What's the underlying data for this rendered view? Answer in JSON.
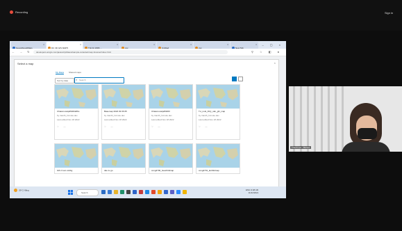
{
  "meeting": {
    "recording_label": "Recording",
    "sign_in_label": "Sign in",
    "participant_name": "Thanh Lan - BA/QA"
  },
  "browser": {
    "tabs": [
      {
        "label": "GeoodGoodMaps",
        "icon": "blue-circle-icon",
        "color": "#2b6cc4",
        "active": false
      },
      {
        "label": "DC 3D GIS MAPS",
        "icon": "orange-circle-icon",
        "color": "#e08a1e",
        "active": true
      },
      {
        "label": "Trả hờ 2396 ...",
        "icon": "orange-circle-icon",
        "color": "#e08a1e",
        "active": false
      },
      {
        "label": "xxx",
        "icon": "orange-circle-icon",
        "color": "#e08a1e",
        "active": false
      },
      {
        "label": "Untitled",
        "icon": "orange-circle-icon",
        "color": "#e08a1e",
        "active": false
      },
      {
        "label": "xxx",
        "icon": "orange-circle-icon",
        "color": "#e08a1e",
        "active": false
      },
      {
        "label": "New Tab",
        "icon": "blue-circle-icon",
        "color": "#2b6cc4",
        "active": false
      }
    ],
    "url": "developers.arcgis.com/javascript/latest/sample-code/webmap-browser/index.html"
  },
  "dialog": {
    "title": "Select a map",
    "tabs": {
      "my_maps": "My Maps",
      "shared_maps": "Shared maps"
    },
    "filter_label": "Sort by date",
    "search_placeholder": "Search",
    "select_label": "Select",
    "cards": [
      {
        "title": "Chiasmocatpdf3d04dfbs",
        "meta1": "by trandh_hcmute.dev",
        "meta2": "Last edited Nov 18 2022",
        "actions": "♡ ⋯"
      },
      {
        "title": "Basemap 2022 03 06 05",
        "meta1": "by trandh_hcmute.dev",
        "meta2": "Last edited Nov 18 2022",
        "actions": "♡ ⋯"
      },
      {
        "title": "Chiasmocatpdf3d03",
        "meta1": "by trandh_hcmute.dev",
        "meta2": "Last edited Nov 18 2022",
        "actions": "♡ ⋯"
      },
      {
        "title": "Tư_nuôi_thủy_sản_ghi_map",
        "meta1": "by trandh_hcmute.dev",
        "meta2": "Last edited Nov 18 2022",
        "actions": "♡ ⋯"
      },
      {
        "title": "GIS 3 sun cobbg",
        "meta1": "",
        "meta2": "",
        "actions": ""
      },
      {
        "title": "dau tu go",
        "meta1": "",
        "meta2": "",
        "actions": ""
      },
      {
        "title": "cong2700_hoach3dmap",
        "meta1": "",
        "meta2": "",
        "actions": ""
      },
      {
        "title": "cong2701_lanb3dmap",
        "meta1": "",
        "meta2": "",
        "actions": ""
      }
    ]
  },
  "taskbar": {
    "weather_temp": "29°C",
    "weather_desc": "Nắng",
    "search_label": "Search",
    "tray_time": "9:48 AM",
    "tray_date": "11/22/2022",
    "tray_lang": "ENG"
  }
}
